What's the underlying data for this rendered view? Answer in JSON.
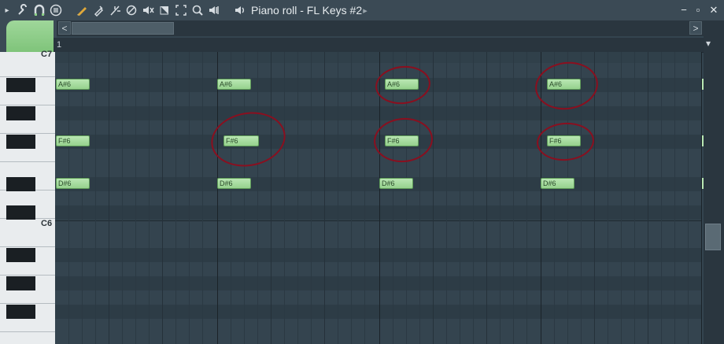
{
  "window": {
    "title": "Piano roll - FL Keys #2",
    "minimize": "−",
    "maximize": "▫",
    "close": "✕"
  },
  "toolbar": {
    "icons": [
      "arrow-right-icon",
      "wrench-icon",
      "magnet-icon",
      "menu-circle-icon",
      "pencil-icon",
      "paint-icon",
      "slice-icon",
      "delete-icon",
      "mute-icon",
      "select-icon",
      "zoom-icon",
      "playback-icon",
      "speaker-icon"
    ],
    "title_arrow": "▸"
  },
  "ruler": {
    "bar_number": "1"
  },
  "keyboard": {
    "octave_labels": [
      "C7",
      "C6"
    ]
  },
  "notes": [
    {
      "label": "A#6"
    },
    {
      "label": "A#6"
    },
    {
      "label": "A#6"
    },
    {
      "label": "A#6"
    },
    {
      "label": "F#6"
    },
    {
      "label": "F#6"
    },
    {
      "label": "F#6"
    },
    {
      "label": "F#6"
    },
    {
      "label": "D#6"
    },
    {
      "label": "D#6"
    },
    {
      "label": "D#6"
    },
    {
      "label": "D#6"
    }
  ],
  "scroll": {
    "left": "<",
    "right": ">",
    "top": "▾"
  },
  "colors": {
    "note_fill": "#a8dca1",
    "annotation": "#8a0f1f",
    "grid": "#34444f",
    "accent": "#8ccf86"
  }
}
